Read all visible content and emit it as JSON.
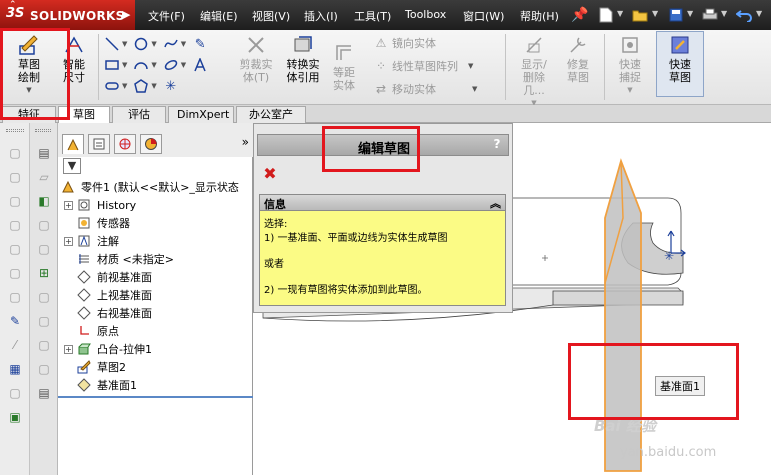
{
  "titlebar": {
    "brand": "SOLIDWORKS",
    "brand_prefix": "3S",
    "menus": [
      "文件(F)",
      "编辑(E)",
      "视图(V)",
      "插入(I)",
      "工具(T)",
      "Toolbox",
      "窗口(W)",
      "帮助(H)"
    ],
    "icons": [
      "pin-icon",
      "new-document-icon",
      "open-folder-icon",
      "save-icon",
      "print-icon",
      "undo-icon"
    ]
  },
  "commands": {
    "sketch": "草图绘制",
    "smart_dimension": "智能尺寸",
    "trim": "剪裁实体(T)",
    "convert": "转换实体引用",
    "offset": "等距实体",
    "mirror": "镜向实体",
    "linear_pattern": "线性草图阵列",
    "move": "移动实体",
    "show_hide": "显示/删除几...",
    "repair": "修复草图",
    "quick_snaps": "快速捕捉",
    "rapid_sketch": "快速草图"
  },
  "tabs": [
    "特征",
    "草图",
    "评估",
    "DimXpert",
    "办公室产品"
  ],
  "tree": {
    "root": "零件1 (默认<<默认>_显示状态",
    "items": [
      {
        "label": "History",
        "expand": true,
        "icon": "history-icon"
      },
      {
        "label": "传感器",
        "expand": false,
        "icon": "sensor-icon"
      },
      {
        "label": "注解",
        "expand": true,
        "icon": "annotation-icon"
      },
      {
        "label": "材质 <未指定>",
        "expand": false,
        "icon": "material-icon"
      },
      {
        "label": "前视基准面",
        "expand": false,
        "icon": "plane-icon"
      },
      {
        "label": "上视基准面",
        "expand": false,
        "icon": "plane-icon"
      },
      {
        "label": "右视基准面",
        "expand": false,
        "icon": "plane-icon"
      },
      {
        "label": "原点",
        "expand": false,
        "icon": "origin-icon"
      },
      {
        "label": "凸台-拉伸1",
        "expand": true,
        "icon": "extrude-icon"
      },
      {
        "label": "草图2",
        "expand": false,
        "icon": "sketch-icon"
      },
      {
        "label": "基准面1",
        "expand": false,
        "icon": "plane-icon"
      }
    ]
  },
  "property_manager": {
    "title": "编辑草图",
    "help": "?",
    "info_title": "信息",
    "info_lines": [
      "选择:",
      "1) 一基准面、平面或边线为实体生成草图",
      "",
      "或者",
      "",
      "2) 一现有草图将实体添加到此草图。"
    ]
  },
  "graphics": {
    "plane_label": "基准面1",
    "watermark": "Bai 经验",
    "watermark_sub": "yan.baidu.com"
  },
  "colors": {
    "highlight_box": "#e3161e",
    "plane_orange": "#f0a040",
    "info_yellow": "#fbfb85"
  }
}
